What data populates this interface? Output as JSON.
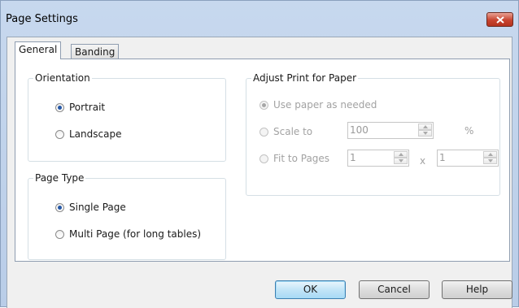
{
  "window": {
    "title": "Page Settings"
  },
  "tabs": [
    {
      "label": "General",
      "selected": true
    },
    {
      "label": "Banding",
      "selected": false
    }
  ],
  "orientation": {
    "label": "Orientation",
    "options": [
      {
        "label": "Portrait",
        "selected": true
      },
      {
        "label": "Landscape",
        "selected": false
      }
    ]
  },
  "page_type": {
    "label": "Page Type",
    "options": [
      {
        "label": "Single Page",
        "selected": true
      },
      {
        "label": "Multi Page (for long tables)",
        "selected": false
      }
    ]
  },
  "adjust": {
    "label": "Adjust Print for Paper",
    "use_paper": "Use paper as needed",
    "scale_to": "Scale to",
    "scale_value": "100",
    "percent": "%",
    "fit_to_pages": "Fit to Pages",
    "fit_w": "1",
    "times": "x",
    "fit_h": "1"
  },
  "buttons": {
    "ok": "OK",
    "cancel": "Cancel",
    "help": "Help"
  },
  "colors": {
    "accent": "#2457a6",
    "title_bar": "#c7d8ee",
    "close": "#c8442f"
  }
}
